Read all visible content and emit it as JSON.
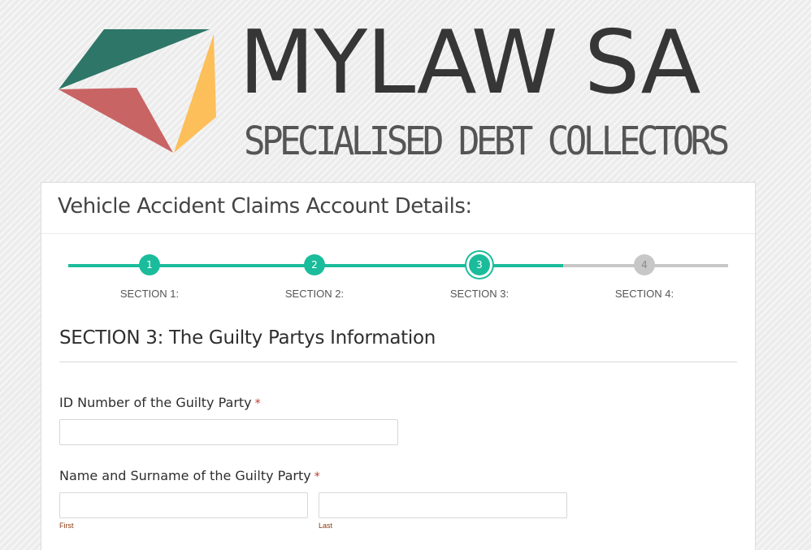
{
  "logo": {
    "title": "MYLAW SA",
    "subtitle": "SPECIALISED DEBT COLLECTORS",
    "colors": {
      "green": "#2e7668",
      "red": "#c96464",
      "yellow": "#fdbf59"
    }
  },
  "form": {
    "title": "Vehicle Accident Claims Account Details:",
    "progress_percent": 75,
    "steps": [
      {
        "number": "1",
        "label": "SECTION 1:",
        "state": "completed"
      },
      {
        "number": "2",
        "label": "SECTION 2:",
        "state": "completed"
      },
      {
        "number": "3",
        "label": "SECTION 3:",
        "state": "current"
      },
      {
        "number": "4",
        "label": "SECTION 4:",
        "state": "pending"
      }
    ],
    "section_title": "SECTION 3: The Guilty Partys Information",
    "fields": {
      "id_number": {
        "label": "ID Number of the Guilty Party",
        "required_mark": "*",
        "value": ""
      },
      "name": {
        "label": "Name and Surname of the Guilty Party",
        "required_mark": "*",
        "first": {
          "sublabel": "First",
          "value": ""
        },
        "last": {
          "sublabel": "Last",
          "value": ""
        }
      }
    },
    "accent_color": "#1bbc9b"
  }
}
